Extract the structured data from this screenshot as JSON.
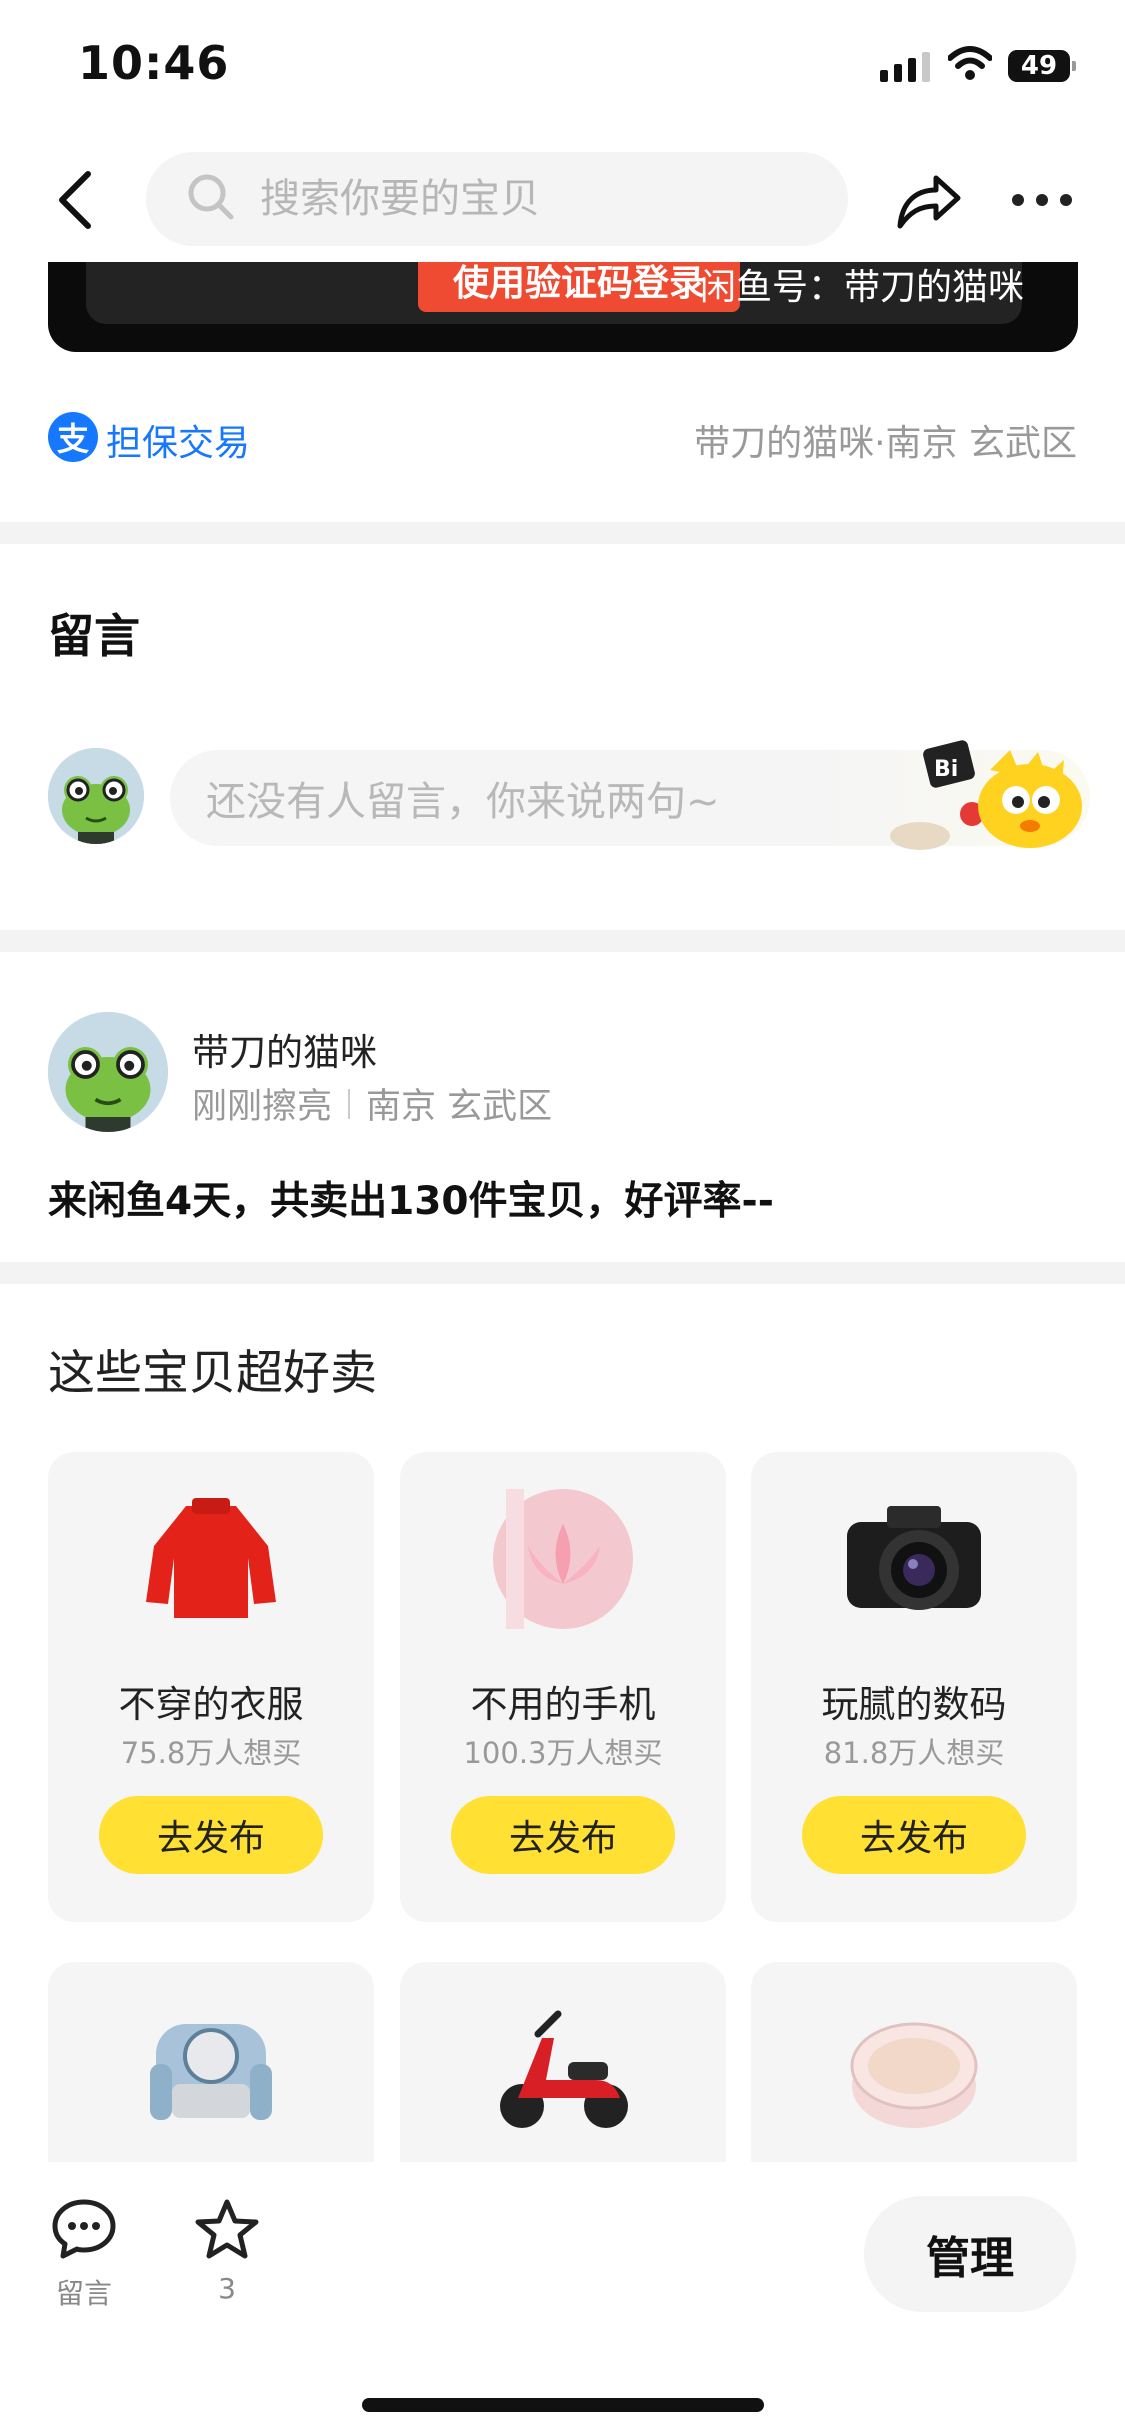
{
  "status_bar": {
    "time": "10:46",
    "battery": "49"
  },
  "header": {
    "search_placeholder": "搜索你要的宝贝"
  },
  "card": {
    "login_label": "使用验证码登录",
    "xianyu_id": "闲鱼号：带刀的猫咪"
  },
  "trade": {
    "icon_text": "支",
    "label": "担保交易",
    "seller_location": "带刀的猫咪·南京 玄武区"
  },
  "messages": {
    "title": "留言",
    "placeholder": "还没有人留言，你来说两句~",
    "mascot_text": "Bi"
  },
  "seller": {
    "name": "带刀的猫咪",
    "activity": "刚刚擦亮",
    "location": "南京 玄武区",
    "stats": "来闲鱼4天，共卖出130件宝贝，好评率--"
  },
  "hot": {
    "title": "这些宝贝超好卖",
    "items": [
      {
        "name": "不穿的衣服",
        "count": "75.8万人想买",
        "button": "去发布",
        "icon": "sweater-icon"
      },
      {
        "name": "不用的手机",
        "count": "100.3万人想买",
        "button": "去发布",
        "icon": "phone-icon"
      },
      {
        "name": "玩腻的数码",
        "count": "81.8万人想买",
        "button": "去发布",
        "icon": "camera-icon"
      },
      {
        "icon": "armchair-icon"
      },
      {
        "icon": "scooter-icon"
      },
      {
        "icon": "cushion-compact-icon"
      }
    ]
  },
  "bottom_bar": {
    "message_label": "留言",
    "favorite_count": "3",
    "manage_label": "管理"
  },
  "colors": {
    "accent_yellow": "#ffe033",
    "alipay_blue": "#1677ff",
    "login_red": "#ef4b32"
  }
}
